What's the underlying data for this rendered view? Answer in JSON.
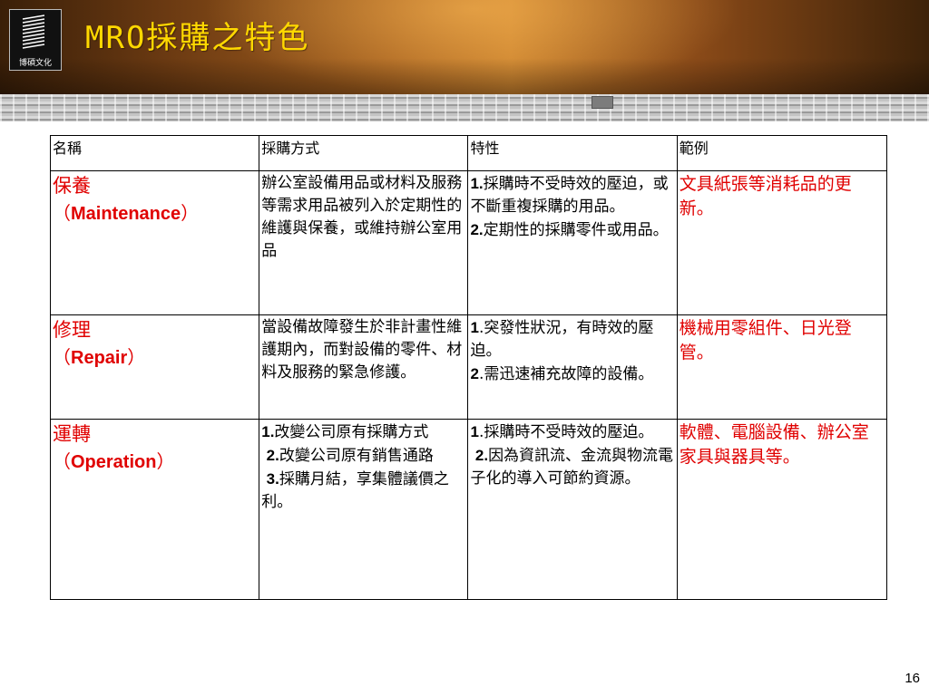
{
  "header": {
    "title": "MRO採購之特色",
    "logo_text": "博碩文化"
  },
  "table": {
    "headers": [
      "名稱",
      "採購方式",
      "特性",
      "範例"
    ],
    "rows": [
      {
        "name_zh": "保養",
        "name_en_open": "（",
        "name_en": "Maintenance",
        "name_en_close": "）",
        "method": "辦公室設備用品或材料及服務等需求用品被列入於定期性的維護與保養，或維持辦公室用品",
        "features": [
          {
            "num": "1.",
            "text": "採購時不受時效的壓迫，或不斷重複採購的用品。"
          },
          {
            "num": "2.",
            "text": "定期性的採購零件或用品。"
          }
        ],
        "example": "文具紙張等消耗品的更新。"
      },
      {
        "name_zh": "修理",
        "name_en_open": "（",
        "name_en": "Repair",
        "name_en_close": "）",
        "method": "當設備故障發生於非計畫性維護期內，而對設備的零件、材料及服務的緊急修護。",
        "features": [
          {
            "num": "1",
            "text": ".突發性狀況，有時效的壓迫。"
          },
          {
            "num": "2",
            "text": ".需迅速補充故障的設備。"
          }
        ],
        "example": "機械用零組件、日光登管。"
      },
      {
        "name_zh": "運轉",
        "name_en_open": "（",
        "name_en": "Operation",
        "name_en_close": "）",
        "methods": [
          {
            "num": "1.",
            "text": "改變公司原有採購方式"
          },
          {
            "num": "2.",
            "text": "改變公司原有銷售通路"
          },
          {
            "num": "3.",
            "text": "採購月結，享集體議價之利。"
          }
        ],
        "features": [
          {
            "num": "1",
            "text": ".採購時不受時效的壓迫。"
          },
          {
            "num": "2.",
            "text": "因為資訊流、金流與物流電子化的導入可節約資源。"
          }
        ],
        "example": "軟體、電腦設備、辦公室家具與器具等。"
      }
    ]
  },
  "page_number": "16",
  "colors": {
    "title": "#ffd800",
    "red_text": "#e00000"
  }
}
